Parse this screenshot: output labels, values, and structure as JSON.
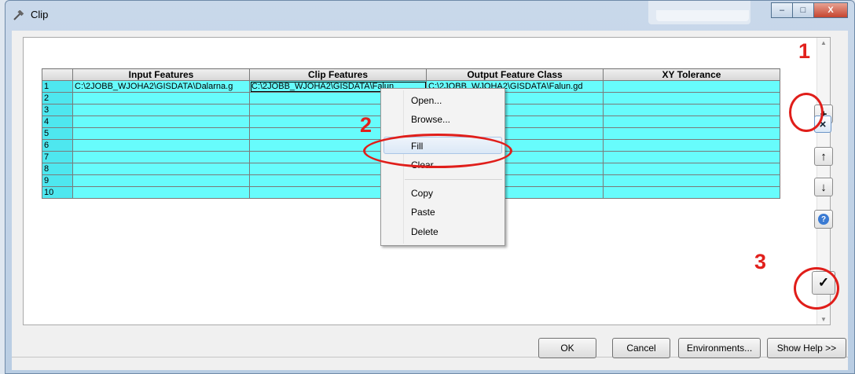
{
  "window": {
    "title": "Clip",
    "background_tabs": [
      "",
      ""
    ]
  },
  "titlebar_buttons": {
    "minimize": "–",
    "maximize": "□",
    "close": "X"
  },
  "grid": {
    "columns": [
      "Input Features",
      "Clip Features",
      "Output Feature Class",
      "XY Tolerance"
    ],
    "rows": [
      {
        "num": "1",
        "input": "C:\\2JOBB_WJOHA2\\GISDATA\\Dalarna.g",
        "clip": "C:\\2JOBB_WJOHA2\\GISDATA\\Falun",
        "output": "C:\\2JOBB_WJOHA2\\GISDATA\\Falun.gd",
        "xy": ""
      },
      {
        "num": "2",
        "input": "",
        "clip": "",
        "output": "",
        "xy": ""
      },
      {
        "num": "3",
        "input": "",
        "clip": "",
        "output": "",
        "xy": ""
      },
      {
        "num": "4",
        "input": "",
        "clip": "",
        "output": "",
        "xy": ""
      },
      {
        "num": "5",
        "input": "",
        "clip": "",
        "output": "",
        "xy": ""
      },
      {
        "num": "6",
        "input": "",
        "clip": "",
        "output": "",
        "xy": ""
      },
      {
        "num": "7",
        "input": "",
        "clip": "",
        "output": "",
        "xy": ""
      },
      {
        "num": "8",
        "input": "",
        "clip": "",
        "output": "",
        "xy": ""
      },
      {
        "num": "9",
        "input": "",
        "clip": "",
        "output": "",
        "xy": ""
      },
      {
        "num": "10",
        "input": "",
        "clip": "",
        "output": "",
        "xy": ""
      }
    ]
  },
  "context_menu": {
    "items": [
      "Open...",
      "Browse...",
      "Fill",
      "Clear",
      "Copy",
      "Paste",
      "Delete"
    ],
    "highlighted": "Fill"
  },
  "side_buttons": {
    "add": "+",
    "remove": "×",
    "up": "↑",
    "down": "↓",
    "help": "?",
    "check": "✓"
  },
  "footer": {
    "ok": "OK",
    "cancel": "Cancel",
    "environments": "Environments...",
    "show_help": "Show Help >>"
  },
  "annotations": {
    "one": "1",
    "two": "2",
    "three": "3"
  },
  "colors": {
    "grid_fill": "#67fcfc",
    "row_header_fill": "#4ee7ef",
    "annotation_red": "#e01e1a"
  },
  "icons": [
    "hammer-icon",
    "plus-icon",
    "close-icon",
    "arrow-up-icon",
    "arrow-down-icon",
    "help-icon",
    "check-icon"
  ]
}
